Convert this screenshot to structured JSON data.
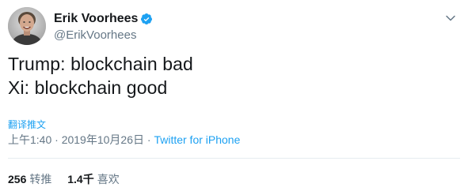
{
  "author": {
    "display_name": "Erik Voorhees",
    "handle": "@ErikVoorhees",
    "verified": true
  },
  "tweet": {
    "lines": [
      "Trump: blockchain bad",
      "Xi: blockchain good"
    ]
  },
  "translate_label": "翻译推文",
  "meta": {
    "timestamp": "上午1:40 · 2019年10月26日",
    "separator": " · ",
    "source": "Twitter for iPhone"
  },
  "stats": {
    "retweets_count": "256",
    "retweets_label": "转推",
    "likes_count": "1.4千",
    "likes_label": "喜欢"
  },
  "colors": {
    "accent": "#1da1f2",
    "text_primary": "#14171a",
    "text_secondary": "#657786",
    "divider": "#e6ecf0"
  },
  "icons": {
    "verified": "verified-badge-icon",
    "caret": "chevron-down-icon",
    "avatar": "avatar"
  }
}
